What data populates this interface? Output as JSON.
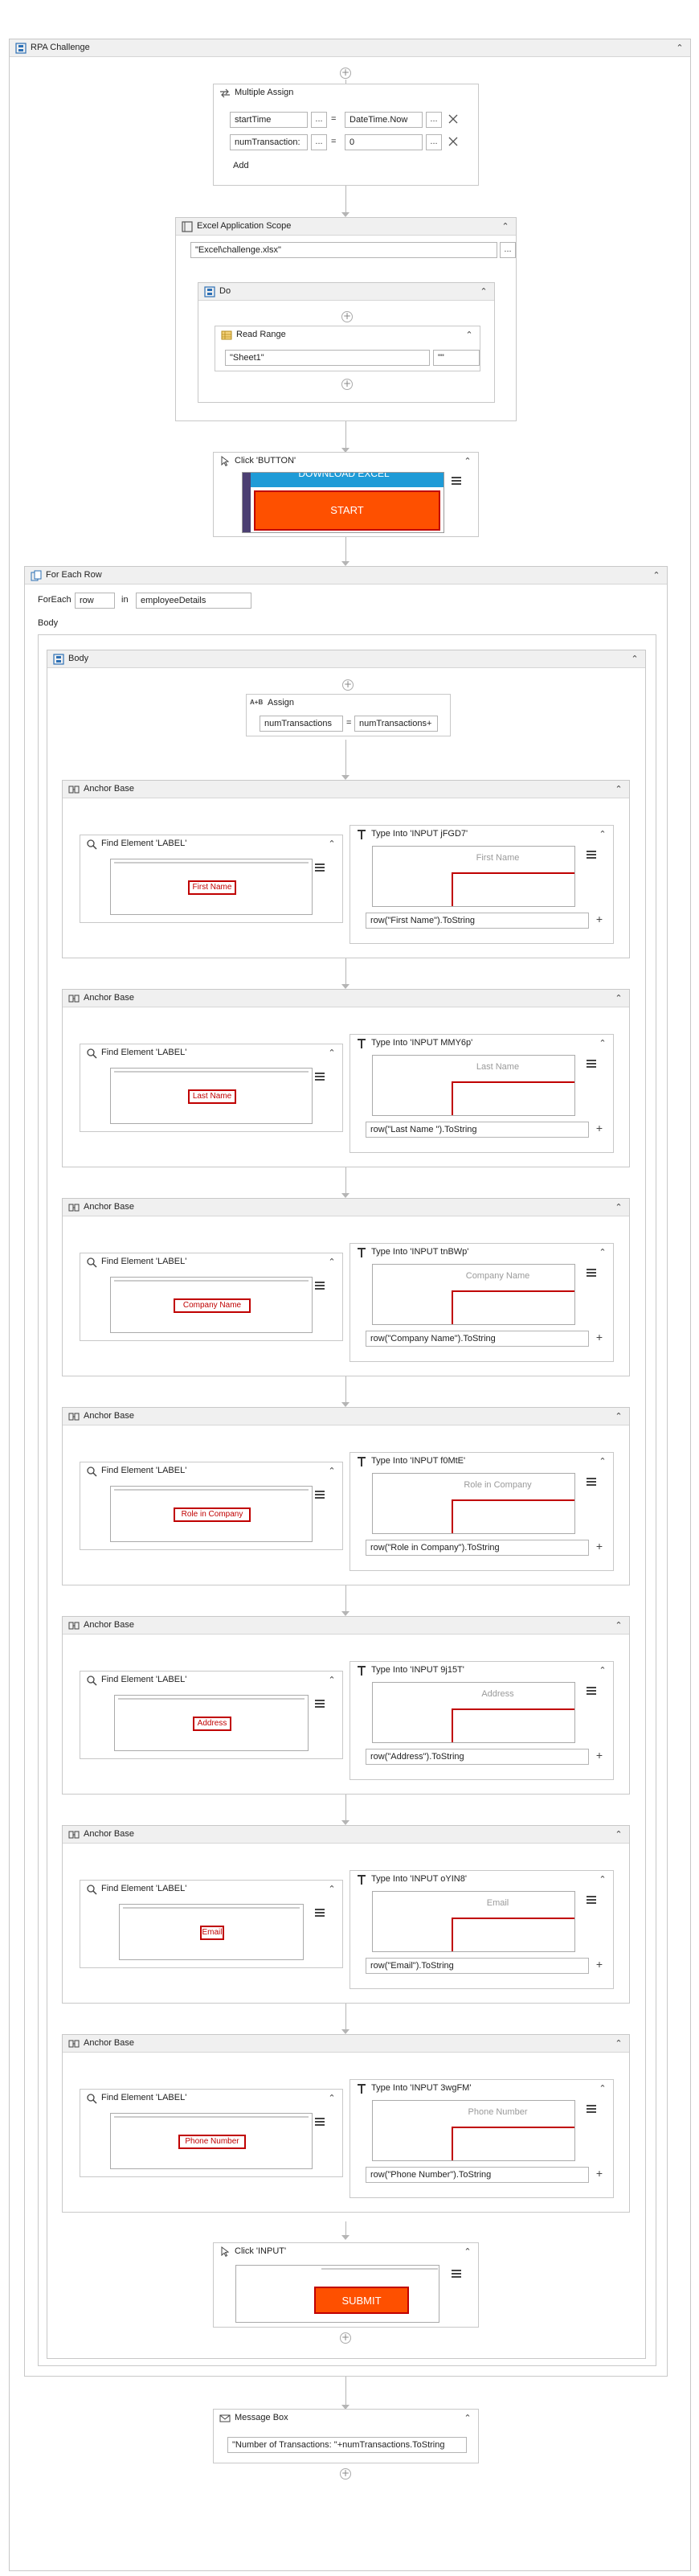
{
  "workflow": {
    "title": "RPA Challenge"
  },
  "multiple_assign": {
    "title": "Multiple Assign",
    "rows": [
      {
        "target": "startTime",
        "value": "DateTime.Now"
      },
      {
        "target": "numTransaction:",
        "value": "0"
      }
    ],
    "add_label": "Add",
    "dots": "...",
    "equals": "="
  },
  "excel_scope": {
    "title": "Excel Application Scope",
    "path": "\"Excel\\challenge.xlsx\"",
    "dots": "...",
    "do_title": "Do",
    "read_range": {
      "title": "Read Range",
      "sheet": "\"Sheet1\"",
      "range": "\"\""
    }
  },
  "click_button": {
    "title": "Click 'BUTTON'",
    "banner_top": "DOWNLOAD EXCEL",
    "banner_main": "START"
  },
  "for_each": {
    "title": "For Each Row",
    "foreach_label": "ForEach",
    "item": "row",
    "in_label": "in",
    "collection": "employeeDetails",
    "body_label": "Body",
    "body_title": "Body",
    "assign": {
      "title": "Assign",
      "target": "numTransactions",
      "equals": "=",
      "value": "numTransactions+"
    }
  },
  "anchors": [
    {
      "title": "Anchor Base",
      "find_title": "Find Element 'LABEL'",
      "label": "First Name",
      "type_title": "Type Into 'INPUT  jFGD7'",
      "placeholder": "First Name",
      "expr": "row(\"First Name\").ToString"
    },
    {
      "title": "Anchor Base",
      "find_title": "Find Element 'LABEL'",
      "label": "Last Name",
      "type_title": "Type Into 'INPUT  MMY6p'",
      "placeholder": "Last Name",
      "expr": "row(\"Last Name \").ToString"
    },
    {
      "title": "Anchor Base",
      "find_title": "Find Element 'LABEL'",
      "label": "Company Name",
      "type_title": "Type Into 'INPUT  tnBWp'",
      "placeholder": "Company Name",
      "expr": "row(\"Company Name\").ToString"
    },
    {
      "title": "Anchor Base",
      "find_title": "Find Element 'LABEL'",
      "label": "Role in Company",
      "type_title": "Type Into 'INPUT  f0MtE'",
      "placeholder": "Role in Company",
      "expr": "row(\"Role in Company\").ToString"
    },
    {
      "title": "Anchor Base",
      "find_title": "Find Element 'LABEL'",
      "label": "Address",
      "type_title": "Type Into 'INPUT  9j15T'",
      "placeholder": "Address",
      "expr": "row(\"Address\").ToString"
    },
    {
      "title": "Anchor Base",
      "find_title": "Find Element 'LABEL'",
      "label": "Email",
      "type_title": "Type Into 'INPUT  oYIN8'",
      "placeholder": "Email",
      "expr": "row(\"Email\").ToString"
    },
    {
      "title": "Anchor Base",
      "find_title": "Find Element 'LABEL'",
      "label": "Phone Number",
      "type_title": "Type Into 'INPUT  3wgFM'",
      "placeholder": "Phone Number",
      "expr": "row(\"Phone Number\").ToString"
    }
  ],
  "click_input": {
    "title": "Click 'INPUT'",
    "button": "SUBMIT"
  },
  "message_box": {
    "title": "Message Box",
    "expr": "\"Number of Transactions: \"+numTransactions.ToString"
  },
  "icons": {
    "collapse": "chevron-up-double-icon",
    "add": "plus-icon",
    "more": "hamburger-icon"
  },
  "colors": {
    "accent": "#fe5000",
    "highlight": "#c00000",
    "blue_banner": "#1f9bd7"
  }
}
